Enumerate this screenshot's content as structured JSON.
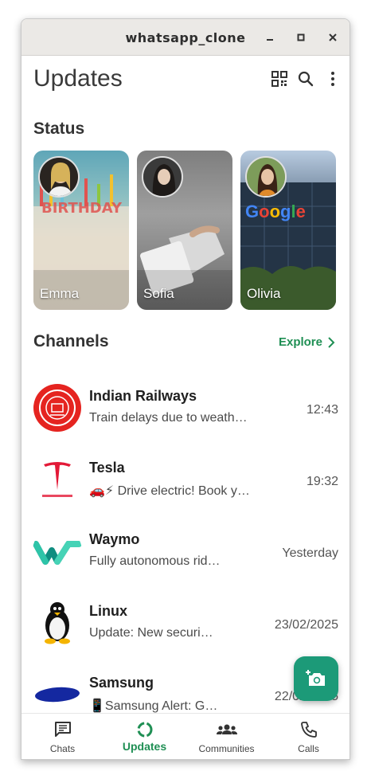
{
  "window": {
    "title": "whatsapp_clone"
  },
  "appbar": {
    "title": "Updates"
  },
  "status": {
    "title": "Status",
    "items": [
      {
        "name": "Emma"
      },
      {
        "name": "Sofia"
      },
      {
        "name": "Olivia"
      }
    ]
  },
  "channels": {
    "title": "Channels",
    "explore_label": "Explore",
    "items": [
      {
        "name": "Indian Railways",
        "message": "Train delays due to weath…",
        "time": "12:43",
        "logo": "indian-railways-logo"
      },
      {
        "name": "Tesla",
        "message": "🚗⚡ Drive electric! Book y…",
        "time": "19:32",
        "logo": "tesla-logo"
      },
      {
        "name": "Waymo",
        "message": "Fully autonomous rid…",
        "time": "Yesterday",
        "logo": "waymo-logo"
      },
      {
        "name": "Linux",
        "message": "Update: New securi…",
        "time": "23/02/2025",
        "logo": "linux-tux-logo"
      },
      {
        "name": "Samsung",
        "message": "📱Samsung Alert: G…",
        "time": "22/02/2025",
        "logo": "samsung-logo"
      }
    ]
  },
  "nav": {
    "items": [
      {
        "label": "Chats",
        "icon": "chat-icon"
      },
      {
        "label": "Updates",
        "icon": "updates-icon",
        "active": true
      },
      {
        "label": "Communities",
        "icon": "communities-icon"
      },
      {
        "label": "Calls",
        "icon": "phone-icon"
      }
    ]
  },
  "colors": {
    "accent": "#1f8f54",
    "fab": "#1c9a78"
  }
}
